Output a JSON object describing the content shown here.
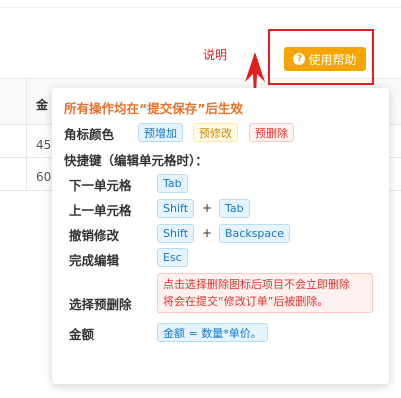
{
  "background": {
    "column_header": "金",
    "cells": [
      "45",
      "60"
    ]
  },
  "annotation": {
    "label": "说明",
    "color": "#e02020"
  },
  "help_button": {
    "label": "使用帮助",
    "icon": "question-circle-icon",
    "color": "#f5a500"
  },
  "popover": {
    "title": "所有操作均在“提交保存”后生效",
    "tag_colors_label": "角标颜色",
    "tags": {
      "add": "预增加",
      "modify": "预修改",
      "delete": "预删除"
    },
    "shortcuts_heading": "快捷键（编辑单元格时）：",
    "shortcuts": [
      {
        "label": "下一单元格",
        "keys": [
          "Tab"
        ]
      },
      {
        "label": "上一单元格",
        "keys": [
          "Shift",
          "Tab"
        ]
      },
      {
        "label": "撤销修改",
        "keys": [
          "Shift",
          "Backspace"
        ]
      },
      {
        "label": "完成编辑",
        "keys": [
          "Esc"
        ]
      }
    ],
    "plus": "+",
    "pre_delete_label": "选择预删除",
    "pre_delete_note": [
      "点击选择删除图标后项目不会立即删除",
      "将会在提交“修改订单”后被删除。"
    ],
    "amount_label": "金额",
    "amount_formula": "金额 = 数量*单价。"
  }
}
